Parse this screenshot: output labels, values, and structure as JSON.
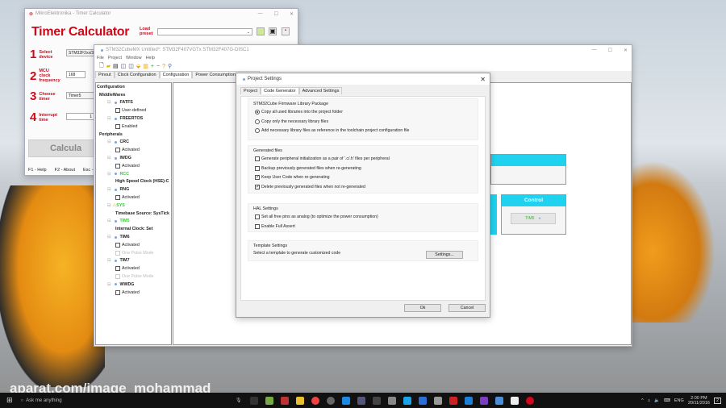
{
  "timer_calc": {
    "window_title": "MikroElektronika - Timer Calculator",
    "app_title": "Timer Calculator",
    "load_preset_label": "Load preset",
    "steps": [
      {
        "n": "1",
        "label": "Select device",
        "value": "STM32F2xx/3x"
      },
      {
        "n": "2",
        "label": "MCU clock frequency",
        "value": "168"
      },
      {
        "n": "3",
        "label": "Choose timer",
        "value": "Timer5"
      },
      {
        "n": "4",
        "label": "Interrupt time",
        "value": "1"
      }
    ],
    "calculate_label": "Calcula",
    "footer": [
      "F1 - Help",
      "F2 - About",
      "Esc -"
    ]
  },
  "cubemx": {
    "window_title": "STM32CubeMX Untitled*: STM32F407VGTx STM32F407G-DISC1",
    "menu": [
      "File",
      "Project",
      "Window",
      "Help"
    ],
    "tabs": [
      "Pinout",
      "Clock Configuration",
      "Configuration",
      "Power Consumption Calculator"
    ],
    "tree": [
      {
        "t": "Configuration",
        "lvl": 0,
        "k": "bold"
      },
      {
        "t": "MiddleWares",
        "lvl": 1,
        "k": "bold"
      },
      {
        "t": "FATFS",
        "lvl": 2,
        "k": "node"
      },
      {
        "t": "User-defined",
        "lvl": 3,
        "k": "cb"
      },
      {
        "t": "FREERTOS",
        "lvl": 2,
        "k": "node"
      },
      {
        "t": "Enabled",
        "lvl": 3,
        "k": "cb"
      },
      {
        "t": "Peripherals",
        "lvl": 1,
        "k": "bold"
      },
      {
        "t": "CRC",
        "lvl": 2,
        "k": "node"
      },
      {
        "t": "Activated",
        "lvl": 3,
        "k": "cb"
      },
      {
        "t": "IWDG",
        "lvl": 2,
        "k": "node"
      },
      {
        "t": "Activated",
        "lvl": 3,
        "k": "cb"
      },
      {
        "t": "RCC",
        "lvl": 2,
        "k": "green"
      },
      {
        "t": "High Speed Clock (HSE):C",
        "lvl": 3,
        "k": "bold"
      },
      {
        "t": "RNG",
        "lvl": 2,
        "k": "node"
      },
      {
        "t": "Activated",
        "lvl": 3,
        "k": "cb"
      },
      {
        "t": "SYS",
        "lvl": 2,
        "k": "warn"
      },
      {
        "t": "Timebase Source: SysTick",
        "lvl": 3,
        "k": "bold"
      },
      {
        "t": "TIM5",
        "lvl": 2,
        "k": "green"
      },
      {
        "t": "Internal Clock: Set",
        "lvl": 3,
        "k": "bold"
      },
      {
        "t": "TIM6",
        "lvl": 2,
        "k": "node"
      },
      {
        "t": "Activated",
        "lvl": 3,
        "k": "cb"
      },
      {
        "t": "One Pulse Mode",
        "lvl": 3,
        "k": "dim"
      },
      {
        "t": "TIM7",
        "lvl": 2,
        "k": "node"
      },
      {
        "t": "Activated",
        "lvl": 3,
        "k": "cb"
      },
      {
        "t": "One Pulse Mode",
        "lvl": 3,
        "k": "dim"
      },
      {
        "t": "WWDG",
        "lvl": 2,
        "k": "node"
      },
      {
        "t": "Activated",
        "lvl": 3,
        "k": "cb"
      }
    ],
    "control_label": "Control",
    "tim5_button": "TIM5"
  },
  "dialog": {
    "title": "Project Settings",
    "tabs": [
      "Project",
      "Code Generator",
      "Advanced Settings"
    ],
    "fw_group": "STM32Cube Firmware Library Package",
    "fw_options": [
      {
        "label": "Copy all used libraries into the project folder",
        "selected": true
      },
      {
        "label": "Copy only the necessary library files",
        "selected": false
      },
      {
        "label": "Add necessary library files as reference in the toolchain project configuration file",
        "selected": false
      }
    ],
    "gen_group": "Generated files",
    "gen_options": [
      {
        "label": "Generate peripheral initialization as a pair of '.c/.h' files per peripheral",
        "checked": false
      },
      {
        "label": "Backup previously generated files when re-generating",
        "checked": false
      },
      {
        "label": "Keep User Code when re-generating",
        "checked": true
      },
      {
        "label": "Delete previously generated files when not re-generated",
        "checked": true
      }
    ],
    "hal_group": "HAL Settings",
    "hal_options": [
      {
        "label": "Set all free pins as analog (to optimize the power consumption)",
        "checked": false
      },
      {
        "label": "Enable Full Assert",
        "checked": false
      }
    ],
    "template_group": "Template Settings",
    "template_text": "Select a template to generate customized code",
    "settings_button": "Settings...",
    "ok": "Ok",
    "cancel": "Cancel"
  },
  "taskbar": {
    "search": "Ask me anything",
    "lang": "ENG",
    "time": "2:00 PM",
    "date": "20/11/2016",
    "notif": "2"
  },
  "watermark": "aparat.com/image_mohammad"
}
